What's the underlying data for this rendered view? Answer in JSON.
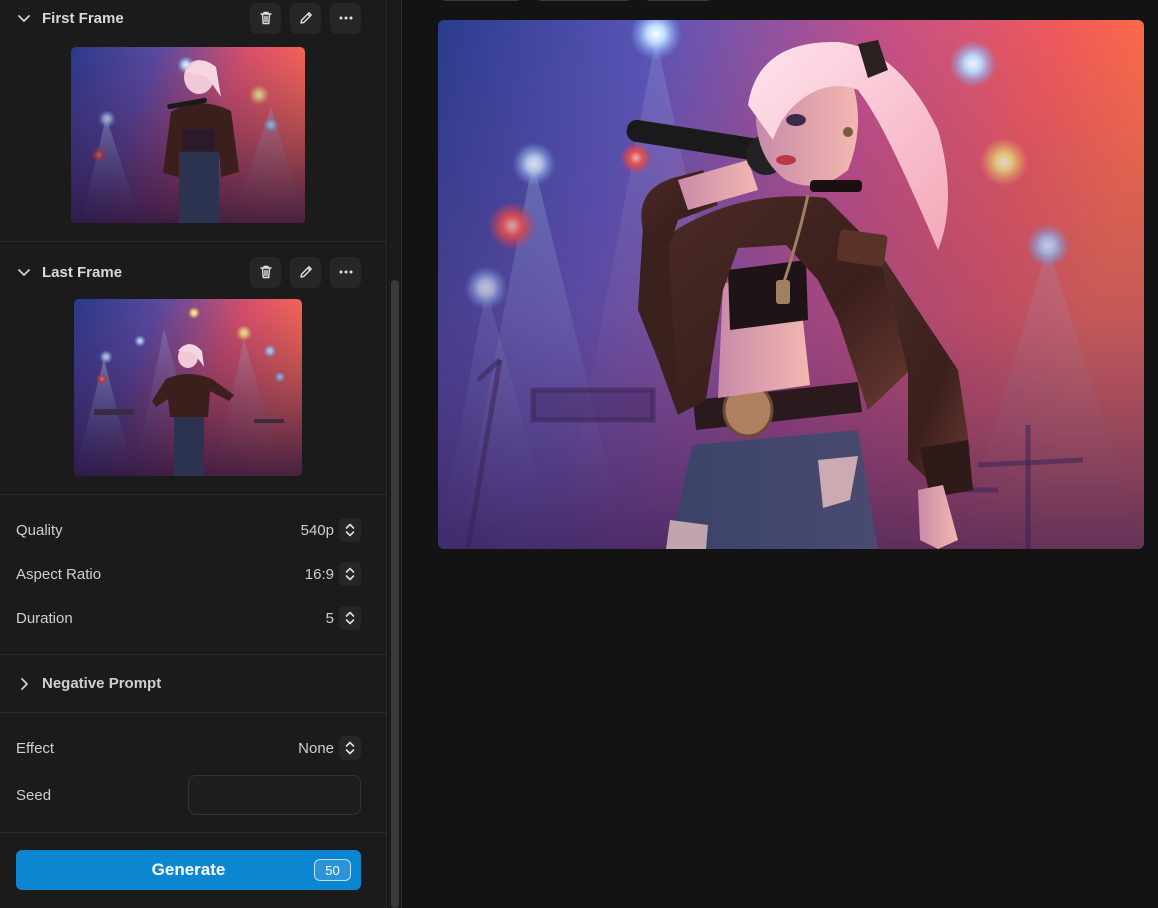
{
  "frames": {
    "first": {
      "title": "First Frame"
    },
    "last": {
      "title": "Last Frame"
    }
  },
  "settings": {
    "quality": {
      "label": "Quality",
      "value": "540p"
    },
    "aspect_ratio": {
      "label": "Aspect Ratio",
      "value": "16:9"
    },
    "duration": {
      "label": "Duration",
      "value": "5"
    }
  },
  "negative_prompt": {
    "label": "Negative Prompt"
  },
  "effect": {
    "label": "Effect",
    "value": "None"
  },
  "seed": {
    "label": "Seed",
    "value": ""
  },
  "generate": {
    "label": "Generate",
    "credits": "50"
  },
  "icons": {
    "collapse": "chevron-down-icon",
    "expand": "chevron-right-icon",
    "delete": "trash-icon",
    "edit": "pencil-icon",
    "more": "more-horizontal-icon",
    "stepper": "up-down-chevron-icon"
  },
  "colors": {
    "accent": "#0d86d2",
    "panel": "#1b1b1b",
    "background": "#131313"
  }
}
